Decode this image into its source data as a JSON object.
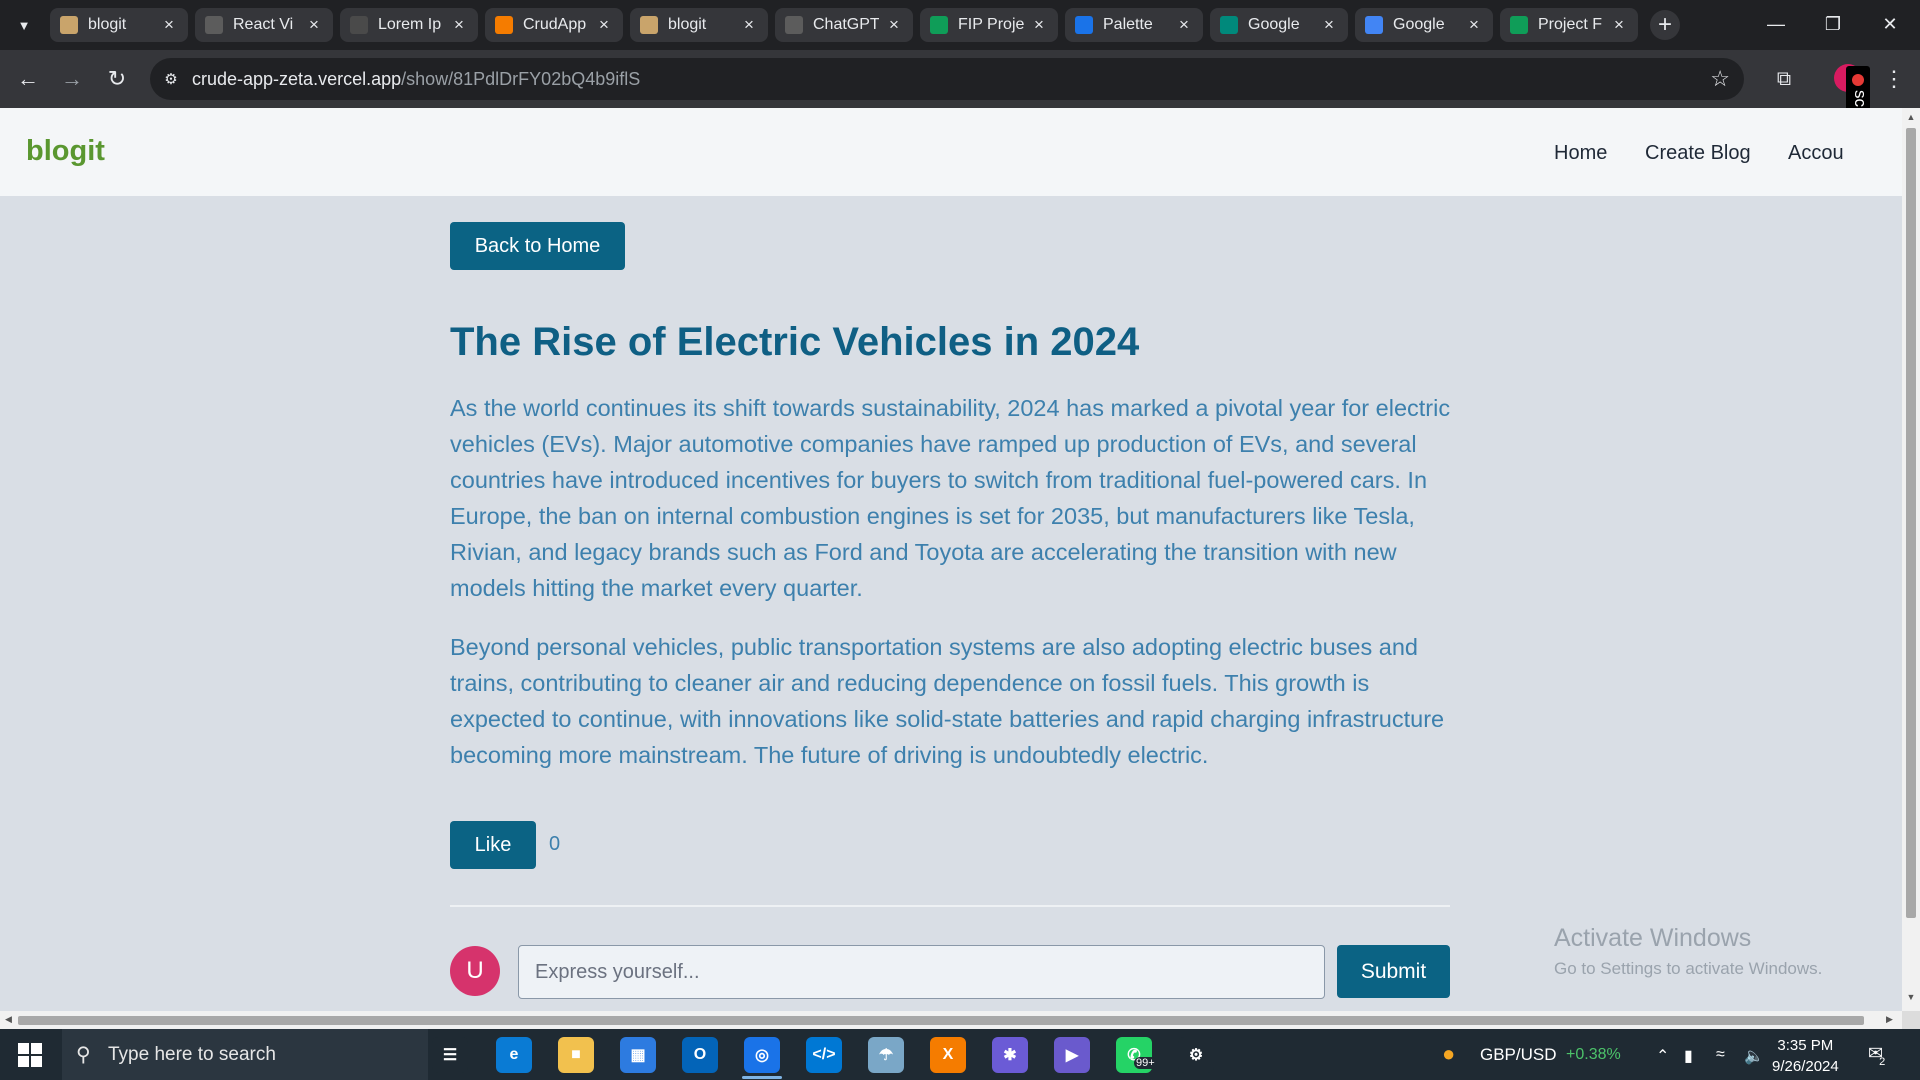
{
  "browser": {
    "tabs": [
      {
        "title": "blogit",
        "icon": "blogit-favicon",
        "color": "#c9a46b"
      },
      {
        "title": "React Vi",
        "icon": "chatgpt-favicon",
        "color": "#5c5c5c"
      },
      {
        "title": "Lorem Ip",
        "icon": "doc-favicon",
        "color": "#4a4a4a"
      },
      {
        "title": "CrudApp",
        "icon": "firebase-favicon",
        "color": "#f57c00"
      },
      {
        "title": "blogit",
        "icon": "blogit-favicon",
        "color": "#c9a46b"
      },
      {
        "title": "ChatGPT",
        "icon": "chatgpt-favicon",
        "color": "#5c5c5c"
      },
      {
        "title": "FIP Proje",
        "icon": "sheets-favicon",
        "color": "#0f9d58"
      },
      {
        "title": "Palette",
        "icon": "palette-favicon",
        "color": "#1a73e8"
      },
      {
        "title": "Google",
        "icon": "google-meet-favicon",
        "color": "#00897b"
      },
      {
        "title": "Google",
        "icon": "google-favicon",
        "color": "#4285f4"
      },
      {
        "title": "Project F",
        "icon": "sheets-favicon",
        "color": "#0f9d58"
      }
    ],
    "url_host": "crude-app-zeta.vercel.app",
    "url_path": "/show/81PdlDrFY02bQ4b9iflS"
  },
  "screenrec_label": "screenrec",
  "site": {
    "brand": "blogit",
    "nav": [
      "Home",
      "Create Blog",
      "Accou"
    ]
  },
  "post": {
    "back_label": "Back to Home",
    "title": "The Rise of Electric Vehicles in 2024",
    "paragraphs": [
      "As the world continues its shift towards sustainability, 2024 has marked a pivotal year for electric vehicles (EVs). Major automotive companies have ramped up production of EVs, and several countries have introduced incentives for buyers to switch from traditional fuel-powered cars. In Europe, the ban on internal combustion engines is set for 2035, but manufacturers like Tesla, Rivian, and legacy brands such as Ford and Toyota are accelerating the transition with new models hitting the market every quarter.",
      "Beyond personal vehicles, public transportation systems are also adopting electric buses and trains, contributing to cleaner air and reducing dependence on fossil fuels. This growth is expected to continue, with innovations like solid-state batteries and rapid charging infrastructure becoming more mainstream. The future of driving is undoubtedly electric."
    ],
    "like_label": "Like",
    "like_count": "0"
  },
  "comment": {
    "avatar_letter": "U",
    "placeholder": "Express yourself...",
    "value": "",
    "submit_label": "Submit"
  },
  "watermark": {
    "line1": "Activate Windows",
    "line2": "Go to Settings to activate Windows."
  },
  "taskbar": {
    "search_placeholder": "Type here to search",
    "apps": [
      "task-view-icon",
      "edge-icon",
      "file-explorer-icon",
      "microsoft-store-icon",
      "outlook-icon",
      "chrome-icon",
      "vscode-icon",
      "paint-icon",
      "xampp-icon",
      "settings-gear-app-icon",
      "copilot-icon",
      "whatsapp-icon",
      "settings-icon"
    ],
    "whatsapp_badge": "99+",
    "ticker_label": "GBP/USD",
    "ticker_change": "+0.38%",
    "time": "3:35 PM",
    "date": "9/26/2024",
    "notification_count": "2"
  },
  "colors": {
    "accent": "#0b6384",
    "title": "#0f5f84",
    "body_text": "#3d80ad",
    "brand": "#5a9730",
    "page_bg": "#d9dee5"
  }
}
